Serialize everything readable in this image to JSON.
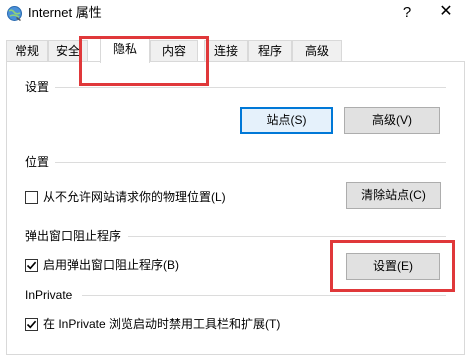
{
  "window": {
    "title": "Internet 属性",
    "help_label": "?",
    "close_label": "✕",
    "icon": "internet-options-globe-icon"
  },
  "tabs": [
    {
      "label": "常规",
      "active": false
    },
    {
      "label": "安全",
      "active": false
    },
    {
      "label": "隐私",
      "active": true
    },
    {
      "label": "内容",
      "active": false
    },
    {
      "label": "连接",
      "active": false
    },
    {
      "label": "程序",
      "active": false
    },
    {
      "label": "高级",
      "active": false
    }
  ],
  "settings": {
    "title": "设置",
    "sites_button": "站点(S)",
    "advanced_button": "高级(V)"
  },
  "location": {
    "title": "位置",
    "checkbox_label": "从不允许网站请求你的物理位置(L)",
    "checked": false,
    "clear_button": "清除站点(C)"
  },
  "popup": {
    "title": "弹出窗口阻止程序",
    "checkbox_label": "启用弹出窗口阻止程序(B)",
    "checked": true,
    "settings_button": "设置(E)"
  },
  "inprivate": {
    "title": "InPrivate",
    "checkbox_label": "在 InPrivate 浏览启动时禁用工具栏和扩展(T)",
    "checked": true
  },
  "colors": {
    "highlight": "#e0383a",
    "focus_border": "#0078d7"
  }
}
